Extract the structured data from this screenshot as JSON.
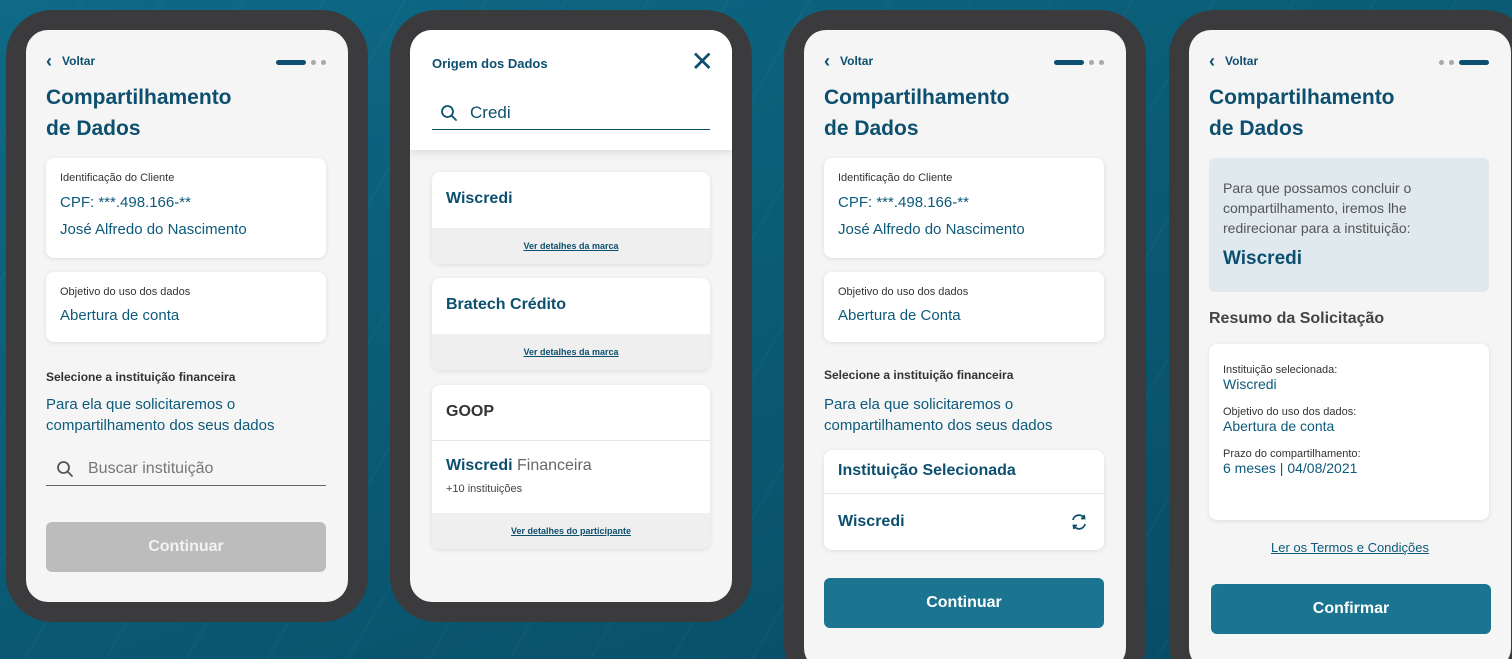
{
  "screens": [
    {
      "back_label": "Voltar",
      "title_line1": "Compartilhamento",
      "title_line2": "de Dados",
      "client_card": {
        "label": "Identificação do Cliente",
        "cpf": "CPF: ***.498.166-**",
        "name": "José Alfredo do Nascimento"
      },
      "objective_card": {
        "label": "Objetivo do uso dos dados",
        "value": "Abertura de conta"
      },
      "select_label": "Selecione a instituição financeira",
      "select_desc_line1": "Para ela que solicitaremos o",
      "select_desc_line2": "compartilhamento dos seus dados",
      "search_placeholder": "Buscar instituição",
      "continue_label": "Continuar"
    },
    {
      "title": "Origem dos Dados",
      "search_value": "Credi",
      "results": [
        {
          "name": "Wiscredi",
          "link": "Ver detalhes da marca"
        },
        {
          "name": "Bratech Crédito",
          "link": "Ver detalhes da marca"
        }
      ],
      "group_card": {
        "name": "GOOP",
        "brand_bold": "Wiscredi",
        "brand_rest": "Financeira",
        "count": "+10 instituições",
        "link": "Ver detalhes do participante"
      }
    },
    {
      "back_label": "Voltar",
      "title_line1": "Compartilhamento",
      "title_line2": "de Dados",
      "client_card": {
        "label": "Identificação do Cliente",
        "cpf": "CPF: ***.498.166-**",
        "name": "José Alfredo do Nascimento"
      },
      "objective_card": {
        "label": "Objetivo do uso dos dados",
        "value": "Abertura de Conta"
      },
      "select_label": "Selecione a instituição financeira",
      "select_desc_line1": "Para ela que solicitaremos o",
      "select_desc_line2": "compartilhamento dos seus dados",
      "selected_card": {
        "title": "Instituição Selecionada",
        "value": "Wiscredi"
      },
      "continue_label": "Continuar"
    },
    {
      "back_label": "Voltar",
      "title_line1": "Compartilhamento",
      "title_line2": "de Dados",
      "info_line1": "Para que possamos concluir o",
      "info_line2": "compartilhamento, iremos lhe",
      "info_line3": "redirecionar para a instituição:",
      "info_institution": "Wiscredi",
      "summary_title": "Resumo da Solicitação",
      "summary": {
        "inst_label": "Instituição selecionada:",
        "inst_value": "Wiscredi",
        "obj_label": "Objetivo do uso dos dados:",
        "obj_value": "Abertura de conta",
        "term_label": "Prazo do compartilhamento:",
        "term_value": "6 meses | 04/08/2021"
      },
      "terms_link": "Ler os Termos e Condições",
      "confirm_label": "Confirmar"
    }
  ],
  "colors": {
    "primary": "#0d4f6e",
    "button": "#1b7590",
    "disabled": "#bcbcbc",
    "info_bg": "#dfe9ee"
  }
}
